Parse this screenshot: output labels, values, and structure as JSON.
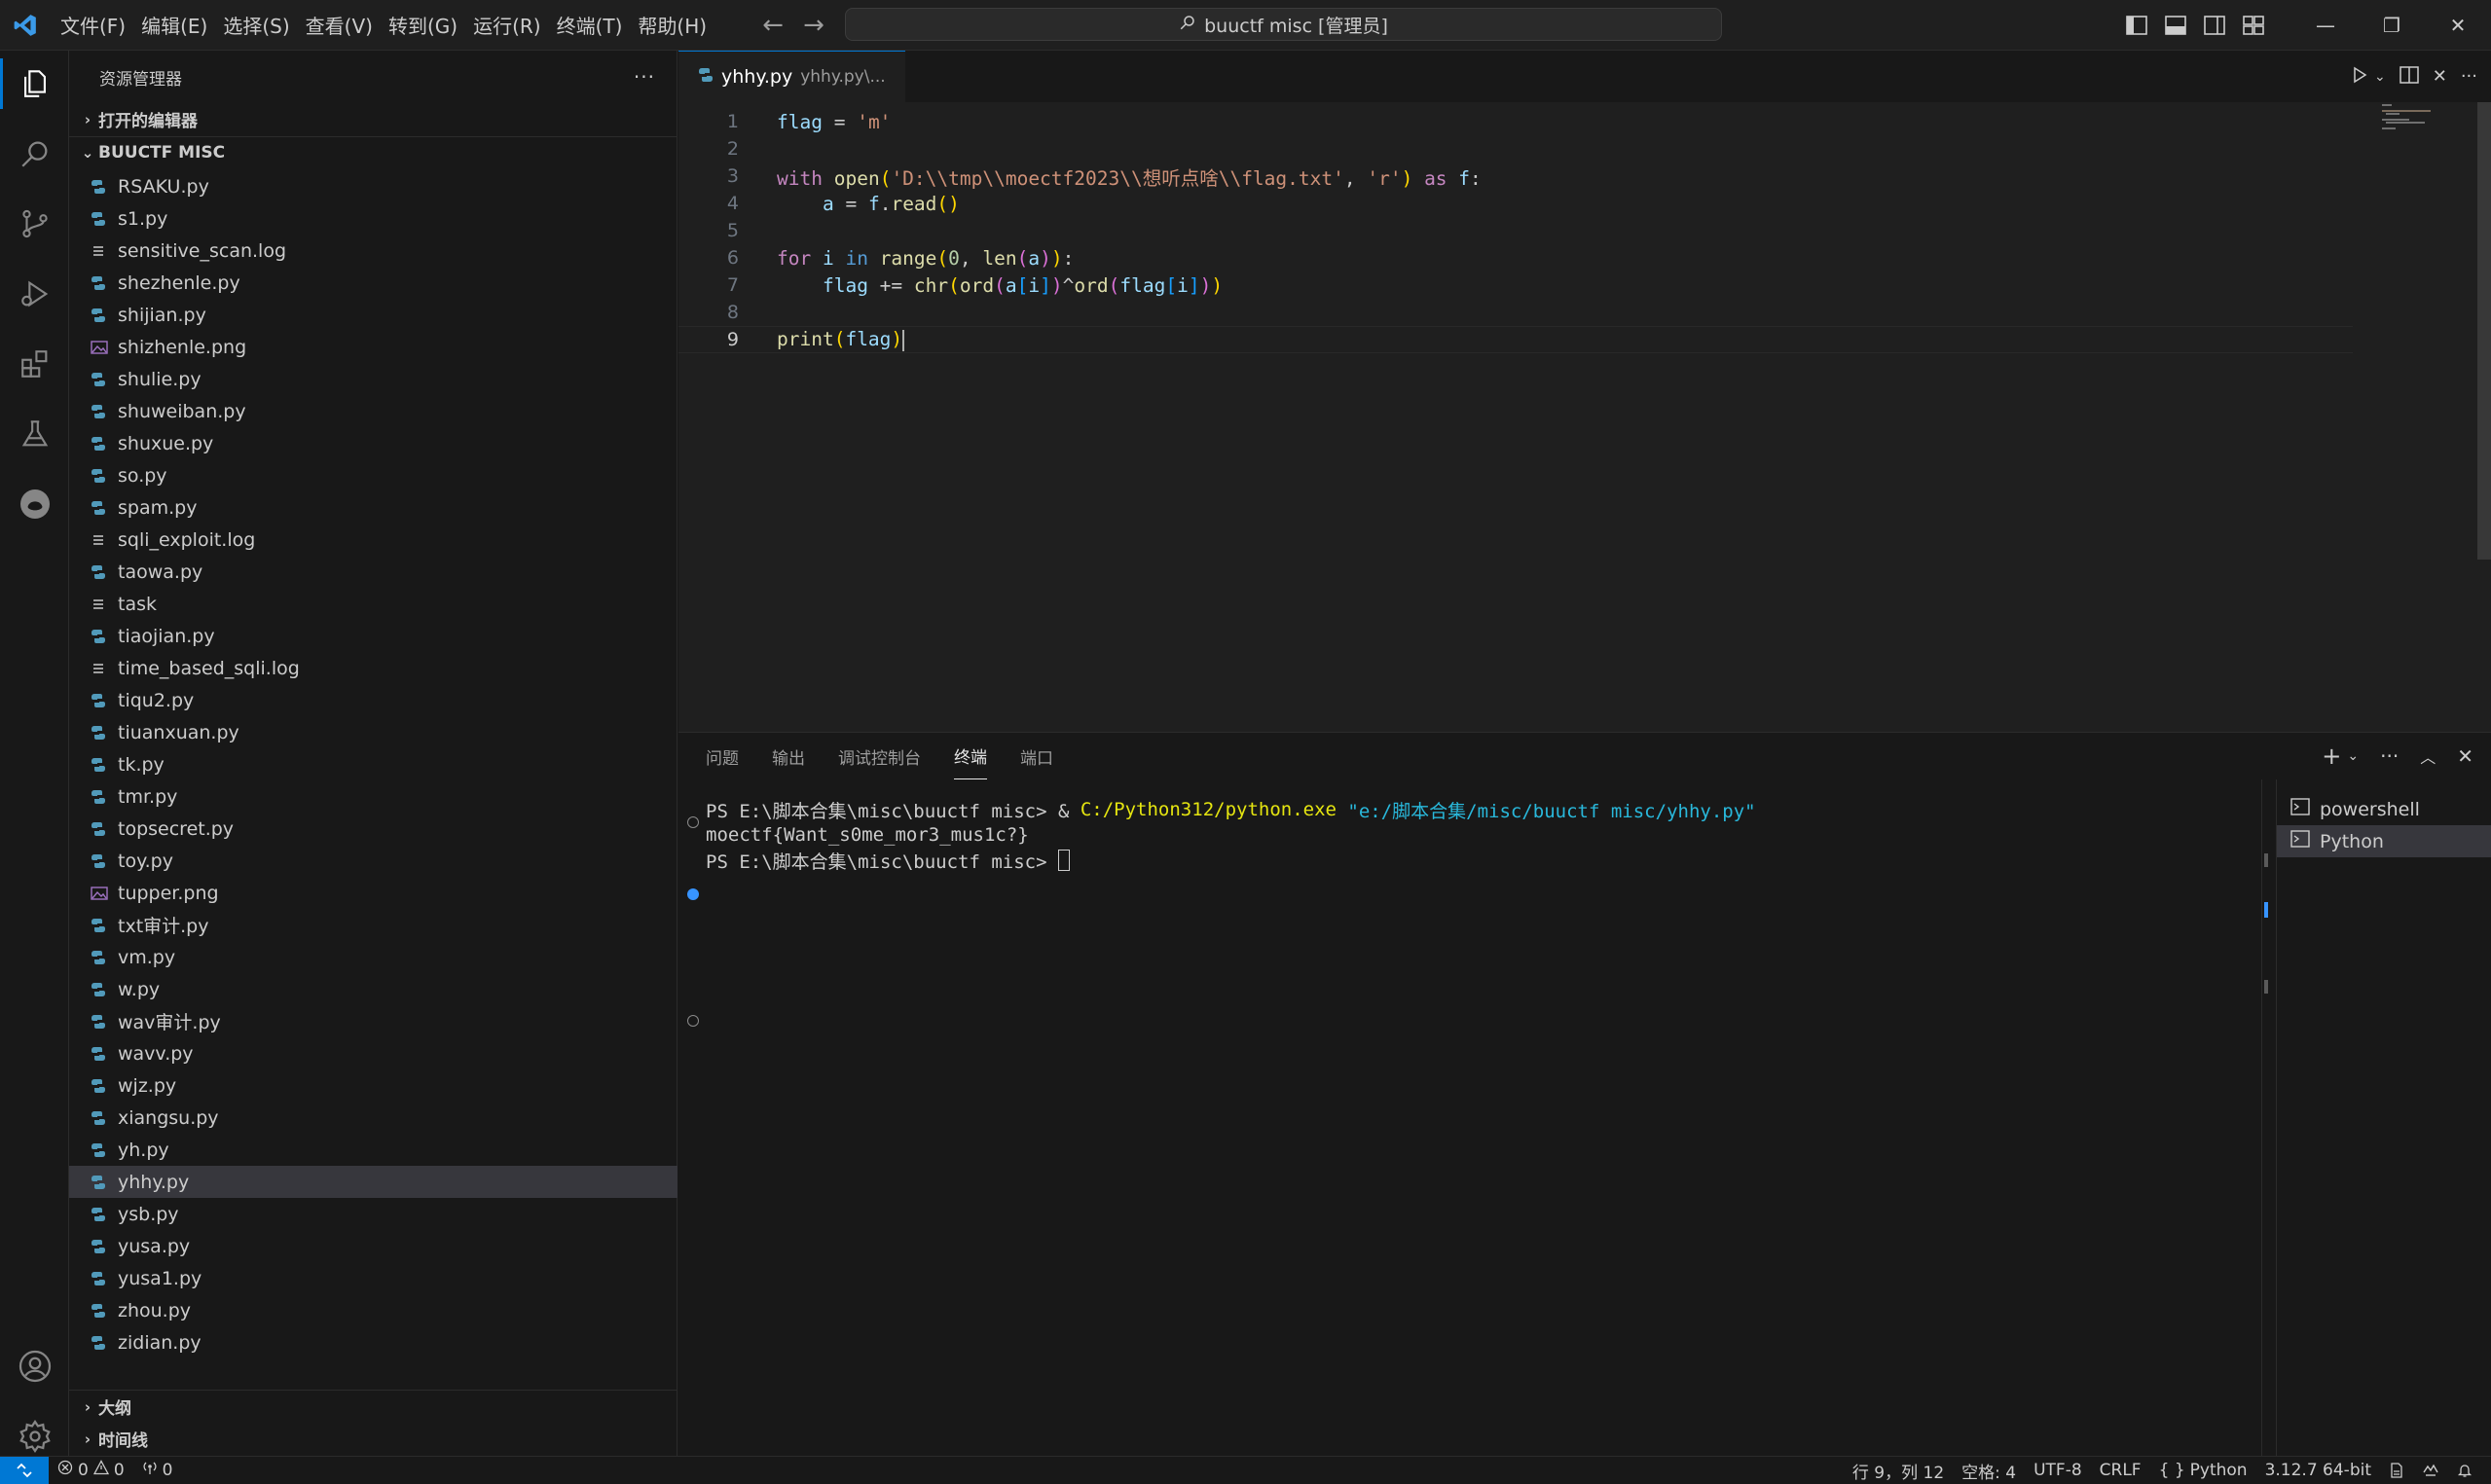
{
  "titlebar": {
    "menu": [
      "文件(F)",
      "编辑(E)",
      "选择(S)",
      "查看(V)",
      "转到(G)",
      "运行(R)",
      "终端(T)",
      "帮助(H)"
    ],
    "search_text": "buuctf misc [管理员]",
    "back_icon": "←",
    "forward_icon": "→",
    "minimize": "—",
    "restore": "❐",
    "close": "✕"
  },
  "sidebar": {
    "title": "资源管理器",
    "more": "···",
    "open_editors": "打开的编辑器",
    "folder": "BUUCTF MISC",
    "outline": "大纲",
    "timeline": "时间线",
    "files": [
      {
        "name": "RSAKU.py",
        "type": "py"
      },
      {
        "name": "s1.py",
        "type": "py"
      },
      {
        "name": "sensitive_scan.log",
        "type": "log"
      },
      {
        "name": "shezhenle.py",
        "type": "py"
      },
      {
        "name": "shijian.py",
        "type": "py"
      },
      {
        "name": "shizhenle.png",
        "type": "png"
      },
      {
        "name": "shulie.py",
        "type": "py"
      },
      {
        "name": "shuweiban.py",
        "type": "py"
      },
      {
        "name": "shuxue.py",
        "type": "py"
      },
      {
        "name": "so.py",
        "type": "py"
      },
      {
        "name": "spam.py",
        "type": "py"
      },
      {
        "name": "sqli_exploit.log",
        "type": "log"
      },
      {
        "name": "taowa.py",
        "type": "py"
      },
      {
        "name": "task",
        "type": "log"
      },
      {
        "name": "tiaojian.py",
        "type": "py"
      },
      {
        "name": "time_based_sqli.log",
        "type": "log"
      },
      {
        "name": "tiqu2.py",
        "type": "py"
      },
      {
        "name": "tiuanxuan.py",
        "type": "py"
      },
      {
        "name": "tk.py",
        "type": "py"
      },
      {
        "name": "tmr.py",
        "type": "py"
      },
      {
        "name": "topsecret.py",
        "type": "py"
      },
      {
        "name": "toy.py",
        "type": "py"
      },
      {
        "name": "tupper.png",
        "type": "png"
      },
      {
        "name": "txt审计.py",
        "type": "py"
      },
      {
        "name": "vm.py",
        "type": "py"
      },
      {
        "name": "w.py",
        "type": "py"
      },
      {
        "name": "wav审计.py",
        "type": "py"
      },
      {
        "name": "wavv.py",
        "type": "py"
      },
      {
        "name": "wjz.py",
        "type": "py"
      },
      {
        "name": "xiangsu.py",
        "type": "py"
      },
      {
        "name": "yh.py",
        "type": "py"
      },
      {
        "name": "yhhy.py",
        "type": "py",
        "selected": true
      },
      {
        "name": "ysb.py",
        "type": "py"
      },
      {
        "name": "yusa.py",
        "type": "py"
      },
      {
        "name": "yusa1.py",
        "type": "py"
      },
      {
        "name": "zhou.py",
        "type": "py"
      },
      {
        "name": "zidian.py",
        "type": "py"
      }
    ]
  },
  "editor": {
    "tab_name": "yhhy.py",
    "tab_desc": "yhhy.py\\...",
    "line_numbers": [
      "1",
      "2",
      "3",
      "4",
      "5",
      "6",
      "7",
      "8",
      "9"
    ],
    "code": {
      "l1_a": "flag",
      "l1_b": " = ",
      "l1_c": "'m'",
      "l3_with": "with",
      "l3_open": "open",
      "l3_p": "(",
      "l3_path": "'D:\\\\tmp\\\\moectf2023\\\\想听点啥\\\\flag.txt'",
      "l3_comma": ", ",
      "l3_r": "'r'",
      "l3_pc": ")",
      "l3_as": " as ",
      "l3_f": "f",
      "l3_colon": ":",
      "l4_a": "a",
      "l4_eq": " = ",
      "l4_f": "f",
      "l4_dot": ".",
      "l4_read": "read",
      "l4_par": "()",
      "l6_for": "for",
      "l6_i": " i ",
      "l6_in": "in",
      "l6_range": " range",
      "l6_p": "(",
      "l6_0": "0",
      "l6_c": ", ",
      "l6_len": "len",
      "l6_p2": "(",
      "l6_a": "a",
      "l6_p3": ")",
      "l6_p4": ")",
      "l6_colon": ":",
      "l7_flag": "flag",
      "l7_op": " += ",
      "l7_chr": "chr",
      "l7_p1": "(",
      "l7_ord": "ord",
      "l7_p2": "(",
      "l7_a": "a",
      "l7_b1": "[",
      "l7_i": "i",
      "l7_b2": "]",
      "l7_p3": ")",
      "l7_x": "^",
      "l7_ord2": "ord",
      "l7_p4": "(",
      "l7_flag2": "flag",
      "l7_b3": "[",
      "l7_i2": "i",
      "l7_b4": "]",
      "l7_p5": ")",
      "l7_p6": ")",
      "l9_print": "print",
      "l9_p": "(",
      "l9_flag": "flag",
      "l9_p2": ")"
    }
  },
  "panel": {
    "tabs": [
      "问题",
      "输出",
      "调试控制台",
      "终端",
      "端口"
    ],
    "active_tab": "终端",
    "terminal": {
      "line1_prompt": "PS E:\\脚本合集\\misc\\buuctf misc> & ",
      "line1_exe": "C:/Python312/python.exe",
      "line1_arg": " \"e:/脚本合集/misc/buuctf misc/yhhy.py\"",
      "line2": "moectf{Want_s0me_mor3_mus1c?}",
      "line3_prompt": "PS E:\\脚本合集\\misc\\buuctf misc> "
    },
    "terminals": [
      "powershell",
      "Python"
    ]
  },
  "statusbar": {
    "errors": "0",
    "warnings": "0",
    "ports": "0",
    "position": "行 9，列 12",
    "spaces": "空格: 4",
    "encoding": "UTF-8",
    "eol": "CRLF",
    "language": "Python",
    "interpreter": "3.12.7 64-bit"
  },
  "colors": {
    "accent": "#0078d4",
    "python_icon": "#519aba",
    "png_icon": "#a074c4"
  }
}
